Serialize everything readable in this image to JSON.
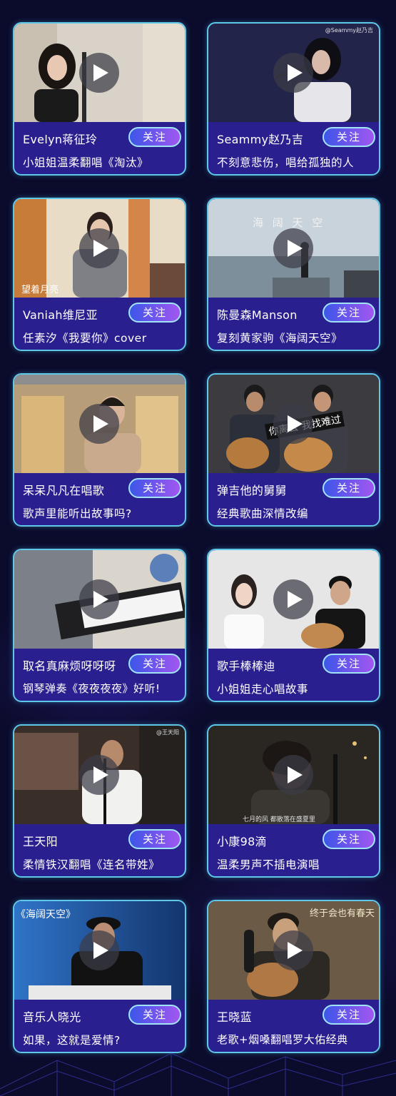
{
  "colors": {
    "background": "#0b0b2c",
    "card": "#2a1f8e",
    "card_border": "#5fc8e8",
    "follow_gradient_start": "#3d56e8",
    "follow_gradient_end": "#a257f0"
  },
  "follow_label": "关注",
  "cards": [
    {
      "author": "Evelyn蒋征玲",
      "desc": "小姐姐温柔翻唱《淘汰》",
      "thumb_text": ""
    },
    {
      "author": "Seammy赵乃吉",
      "desc": "不刻意悲伤，唱给孤独的人",
      "thumb_text": "@Seammy赵乃吉"
    },
    {
      "author": "Vaniah维尼亚",
      "desc": "任素汐《我要你》cover",
      "thumb_text": "望着月亮"
    },
    {
      "author": "陈曼森Manson",
      "desc": "复刻黄家驹《海阔天空》",
      "thumb_text": "海 阔 天 空"
    },
    {
      "author": "呆呆凡凡在唱歌",
      "desc": "歌声里能听出故事吗?",
      "thumb_text": ""
    },
    {
      "author": "弹吉他的舅舅",
      "desc": "经典歌曲深情改编",
      "thumb_text": "你离去 我找难过"
    },
    {
      "author": "取名真麻烦呀呀呀",
      "desc": "钢琴弹奏《夜夜夜夜》好听!",
      "thumb_text": ""
    },
    {
      "author": "歌手棒棒迪",
      "desc": "小姐姐走心唱故事",
      "thumb_text": ""
    },
    {
      "author": "王天阳",
      "desc": "柔情铁汉翻唱《连名带姓》",
      "thumb_text": "@王天阳"
    },
    {
      "author": "小康98滴",
      "desc": "温柔男声不插电演唱",
      "thumb_text": "七月的风 都散落在盛夏里"
    },
    {
      "author": "音乐人晓光",
      "desc": "如果，这就是爱情?",
      "thumb_text": "《海阔天空》"
    },
    {
      "author": "王晓蓝",
      "desc": "老歌+烟嗓翻唱罗大佑经典",
      "thumb_text": "终于会也有春天"
    }
  ]
}
